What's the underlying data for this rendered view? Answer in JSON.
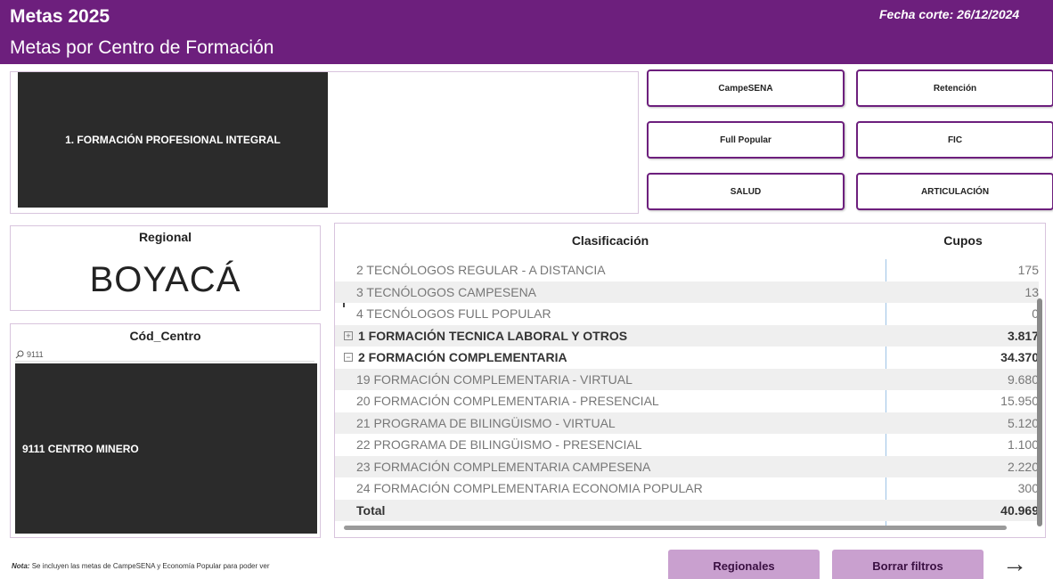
{
  "header": {
    "title": "Metas 2025",
    "subtitle": "Metas por Centro de Formación",
    "date": "Fecha corte: 26/12/2024"
  },
  "filters": {
    "formacion_selected": "1. FORMACIÓN PROFESIONAL INTEGRAL",
    "buttons": [
      "CampeSENA",
      "Retención",
      "Full Popular",
      "FIC",
      "SALUD",
      "ARTICULACIÓN"
    ]
  },
  "regional": {
    "label": "Regional",
    "value": "BOYACÁ"
  },
  "centro": {
    "label": "Cód_Centro",
    "search_value": "9111",
    "selected_item": "9111 CENTRO MINERO"
  },
  "table": {
    "columns": [
      "Clasificación",
      "Cupos"
    ],
    "rows": [
      {
        "name": "2 TECNÓLOGOS REGULAR - A DISTANCIA",
        "value": "175",
        "kind": "child"
      },
      {
        "name": "3 TECNÓLOGOS CAMPESENA",
        "value": "13",
        "kind": "child"
      },
      {
        "name": "4 TECNÓLOGOS FULL POPULAR",
        "value": "0",
        "kind": "child"
      },
      {
        "name": "1 FORMACIÓN TECNICA LABORAL Y OTROS",
        "value": "3.817",
        "kind": "group",
        "toggle": "+"
      },
      {
        "name": "2 FORMACIÓN COMPLEMENTARIA",
        "value": "34.370",
        "kind": "group",
        "toggle": "−"
      },
      {
        "name": "19 FORMACIÓN COMPLEMENTARIA - VIRTUAL",
        "value": "9.680",
        "kind": "child"
      },
      {
        "name": "20 FORMACIÓN COMPLEMENTARIA - PRESENCIAL",
        "value": "15.950",
        "kind": "child"
      },
      {
        "name": "21 PROGRAMA DE BILINGÜISMO - VIRTUAL",
        "value": "5.120",
        "kind": "child"
      },
      {
        "name": "22 PROGRAMA DE BILINGÜISMO - PRESENCIAL",
        "value": "1.100",
        "kind": "child"
      },
      {
        "name": "23 FORMACIÓN COMPLEMENTARIA CAMPESENA",
        "value": "2.220",
        "kind": "child"
      },
      {
        "name": "24 FORMACIÓN COMPLEMENTARIA ECONOMIA POPULAR",
        "value": "300",
        "kind": "child"
      },
      {
        "name": "Total",
        "value": "40.969",
        "kind": "total"
      }
    ]
  },
  "footer": {
    "note_label": "Nota:",
    "note_text": "Se incluyen las metas de CampeSENA y Economía Popular para poder ver",
    "regionales_button": "Regionales",
    "clear_filters_button": "Borrar filtros",
    "arrow_icon": "arrow-right-icon"
  },
  "colors": {
    "brand": "#6d1f7d",
    "footer_button": "#c9a0cf",
    "card_dark": "#2b2b2b"
  }
}
